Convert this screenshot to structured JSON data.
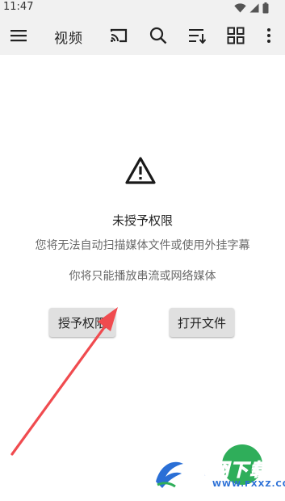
{
  "status_bar": {
    "time": "11:47",
    "icons": [
      "wifi-icon",
      "signal-icon",
      "battery-icon"
    ]
  },
  "app_bar": {
    "title": "视频",
    "actions": [
      "menu-icon",
      "cast-icon",
      "search-icon",
      "sort-icon",
      "grid-view-icon",
      "more-options-icon"
    ]
  },
  "permission_notice": {
    "icon": "warning-icon",
    "title": "未授予权限",
    "line1": "您将无法自动扫描媒体文件或使用外挂字幕",
    "line2": "你将只能播放串流或网络媒体",
    "grant_button_label": "授予权限",
    "open_file_button_label": "打开文件"
  },
  "annotation": {
    "arrow_color": "#f04b4f"
  },
  "watermark": {
    "brand": "飞翔下载",
    "url": "WWW.FXXZ.COM",
    "colors": {
      "primary": "#2a6fd6",
      "green": "#2fae5a"
    }
  },
  "colors": {
    "bar_background": "#f1f1f1",
    "button_background": "#e0e0e0",
    "text_secondary": "#6a6a6a"
  }
}
